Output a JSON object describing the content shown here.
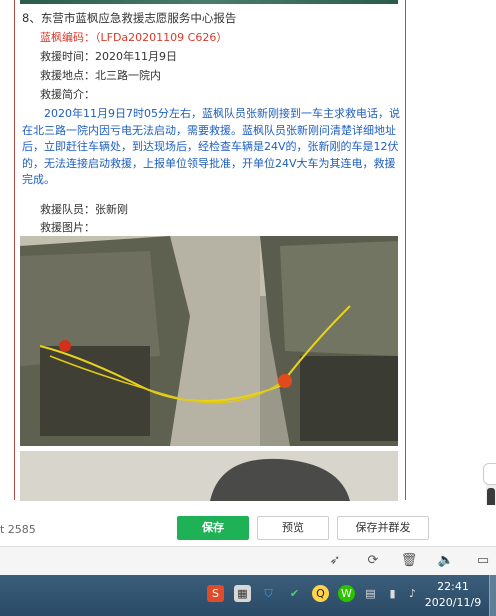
{
  "report": {
    "title": "8、东营市蓝枫应急救援志愿服务中心报告",
    "code_label": "蓝枫编码：",
    "code_value": "（LFDa20201109  C626）",
    "time": "救援时间：2020年11月9日",
    "location": "救援地点：北三路一院内",
    "summary_label": "救援简介：",
    "summary": "2020年11月9日7时05分左右，蓝枫队员张新刚接到一车主求救电话，说在北三路一院内因亏电无法启动，需要救援。蓝枫队员张新刚问清楚详细地址后，立即赶往车辆处，到达现场后，经检查车辆是24V的，张新刚的车是12伏的，无法连接启动救援，上报单位领导批准，开单位24V大车为其连电，救援完成。",
    "members": "救援队员：张新刚",
    "photos_label": "救援图片："
  },
  "toolbar": {
    "word_count": "t 2585",
    "save": "保存",
    "preview": "预览",
    "save_group": "保存并群发"
  },
  "status_icons": [
    "rocket-icon",
    "refresh-icon",
    "trash-icon",
    "speaker-icon",
    "window-icon"
  ],
  "taskbar": {
    "time": "22:41",
    "date": "2020/11/9",
    "tray": [
      "sogou-icon",
      "app-icon",
      "shield-icon",
      "network-check-icon",
      "qq-icon",
      "wechat-icon",
      "clipboard-icon",
      "signal-icon",
      "battery-icon",
      "volume-icon"
    ]
  },
  "colors": {
    "save": "#1fb155",
    "code": "#d93a2b",
    "summary": "#1f5fbf",
    "frame": "#b54a4a"
  }
}
